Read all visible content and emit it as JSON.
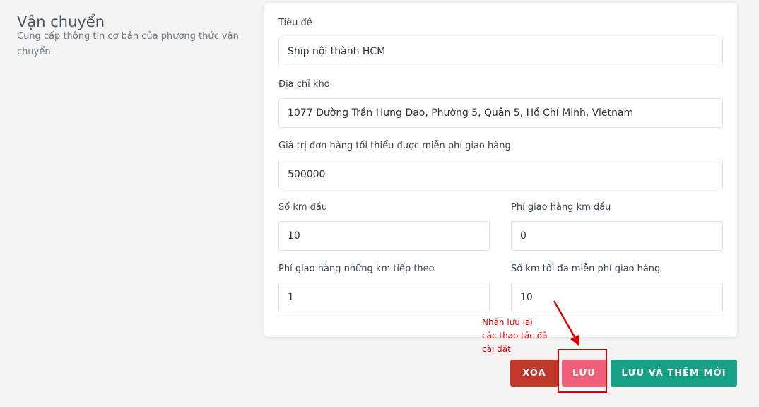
{
  "section": {
    "title": "Vận chuyển",
    "description": "Cung cấp thông tin cơ bản của phương thức vận chuyển."
  },
  "form": {
    "title": {
      "label": "Tiêu đề",
      "value": "Ship nội thành HCM"
    },
    "warehouse_address": {
      "label": "Địa chỉ kho",
      "value": "1077 Đường Trần Hưng Đạo, Phường 5, Quận 5, Hồ Chí Minh, Vietnam"
    },
    "min_order_free_shipping": {
      "label": "Giá trị đơn hàng tối thiểu được miễn phí giao hàng",
      "value": "500000"
    },
    "first_km": {
      "label": "Số km đầu",
      "value": "10"
    },
    "first_km_fee": {
      "label": "Phí giao hàng km đầu",
      "value": "0"
    },
    "next_km_fee": {
      "label": "Phí giao hàng những km tiếp theo",
      "value": "1"
    },
    "max_free_km": {
      "label": "Số km tối đa miễn phí giao hàng",
      "value": "10"
    }
  },
  "actions": {
    "delete_label": "XÓA",
    "save_label": "LƯU",
    "save_new_label": "LƯU VÀ THÊM MỚI"
  },
  "annotation": {
    "text": "Nhấn lưu lại\ncác thao tác đã\ncài đặt",
    "color": "#e00000"
  },
  "colors": {
    "delete": "#c0392b",
    "save": "#f0607a",
    "save_new": "#16a085"
  }
}
